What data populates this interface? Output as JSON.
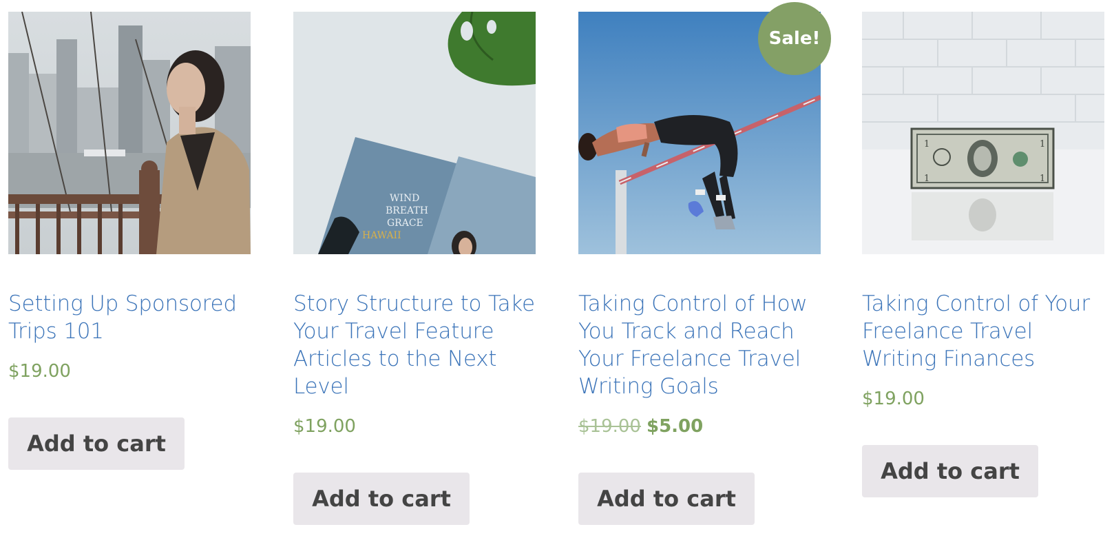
{
  "colors": {
    "title_link": "#3a73b8",
    "price": "#7fa260",
    "old_price": "#a9c296",
    "sale_badge": "#84a066",
    "button_bg": "#e9e6ea",
    "button_text": "#444444"
  },
  "products": [
    {
      "title": "Setting Up Sponsored Trips 101",
      "price": "$19.00",
      "button": "Add to cart",
      "image": "woman-on-bridge-photo"
    },
    {
      "title": "Story Structure to Take Your Travel Feature Articles to the Next Level",
      "price": "$19.00",
      "button": "Add to cart",
      "image": "magazine-and-leaf-photo"
    },
    {
      "title": "Taking Control of How You Track and Reach Your Freelance Travel Writing Goals",
      "old_price": "$19.00",
      "sale_price": "$5.00",
      "badge": "Sale!",
      "button": "Add to cart",
      "image": "high-jumper-photo"
    },
    {
      "title": "Taking Control of Your Freelance Travel Writing Finances",
      "price": "$19.00",
      "button": "Add to cart",
      "image": "dollar-bill-photo"
    }
  ]
}
